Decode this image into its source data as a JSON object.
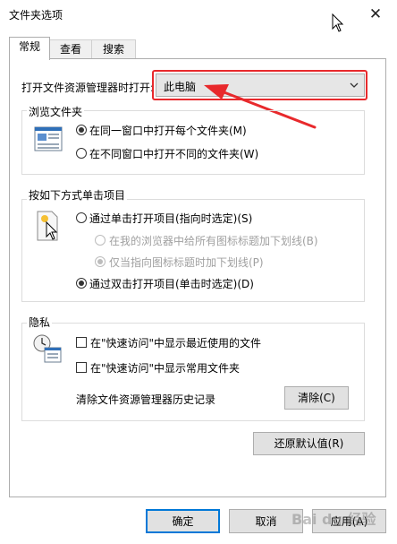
{
  "window": {
    "title": "文件夹选项",
    "close_glyph": "✕"
  },
  "tabs": [
    {
      "label": "常规",
      "active": true
    },
    {
      "label": "查看",
      "active": false
    },
    {
      "label": "搜索",
      "active": false
    }
  ],
  "open_explorer": {
    "label": "打开文件资源管理器时打开:",
    "selected": "此电脑"
  },
  "browse": {
    "title": "浏览文件夹",
    "options": [
      {
        "label": "在同一窗口中打开每个文件夹(M)",
        "checked": true
      },
      {
        "label": "在不同窗口中打开不同的文件夹(W)",
        "checked": false
      }
    ]
  },
  "click": {
    "title": "按如下方式单击项目",
    "single": {
      "label": "通过单击打开项目(指向时选定)(S)",
      "checked": false
    },
    "underline_browser": {
      "label": "在我的浏览器中给所有图标标题加下划线(B)",
      "checked": false,
      "disabled": true
    },
    "underline_point": {
      "label": "仅当指向图标标题时加下划线(P)",
      "checked": true,
      "disabled": true
    },
    "double": {
      "label": "通过双击打开项目(单击时选定)(D)",
      "checked": true
    }
  },
  "privacy": {
    "title": "隐私",
    "recent": {
      "label": "在\"快速访问\"中显示最近使用的文件",
      "checked": false
    },
    "frequent": {
      "label": "在\"快速访问\"中显示常用文件夹",
      "checked": false
    },
    "clear_label": "清除文件资源管理器历史记录",
    "clear_button": "清除(C)"
  },
  "restore_button": "还原默认值(R)",
  "footer": {
    "ok": "确定",
    "cancel": "取消",
    "apply": "应用(A)"
  },
  "watermark": "Bai du 经验",
  "colors": {
    "highlight": "#e8292c",
    "default_button_border": "#0078d7"
  }
}
